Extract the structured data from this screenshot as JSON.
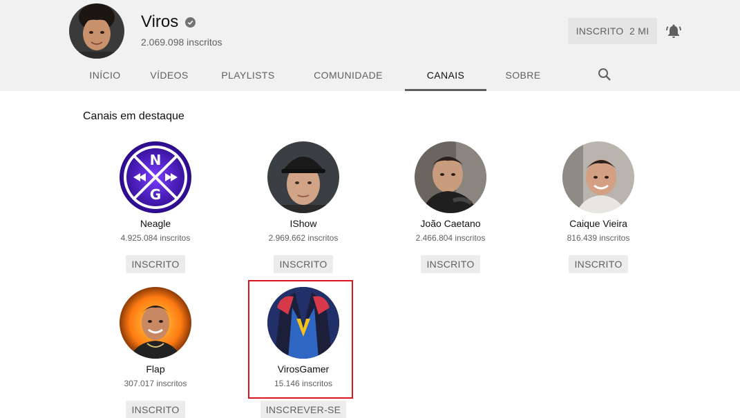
{
  "channel": {
    "name": "Viros",
    "subscribers": "2.069.098 inscritos",
    "subscribe_label": "INSCRITO  2 MI"
  },
  "tabs": [
    {
      "label": "INÍCIO"
    },
    {
      "label": "VÍDEOS"
    },
    {
      "label": "PLAYLISTS"
    },
    {
      "label": "COMUNIDADE"
    },
    {
      "label": "CANAIS"
    },
    {
      "label": "SOBRE"
    }
  ],
  "section": {
    "title": "Canais em destaque"
  },
  "channels": [
    {
      "name": "Neagle",
      "subs": "4.925.084 inscritos",
      "button": "INSCRITO"
    },
    {
      "name": "IShow",
      "subs": "2.969.662 inscritos",
      "button": "INSCRITO"
    },
    {
      "name": "João Caetano",
      "subs": "2.466.804 inscritos",
      "button": "INSCRITO"
    },
    {
      "name": "Caique Vieira",
      "subs": "816.439 inscritos",
      "button": "INSCRITO"
    },
    {
      "name": "Flap",
      "subs": "307.017 inscritos",
      "button": "INSCRITO"
    },
    {
      "name": "VirosGamer",
      "subs": "15.146 inscritos",
      "button": "INSCREVER-SE"
    }
  ],
  "colors": {
    "header_bg": "#f1f1f1",
    "highlight": "#d9141c",
    "button_bg": "#ececec"
  }
}
